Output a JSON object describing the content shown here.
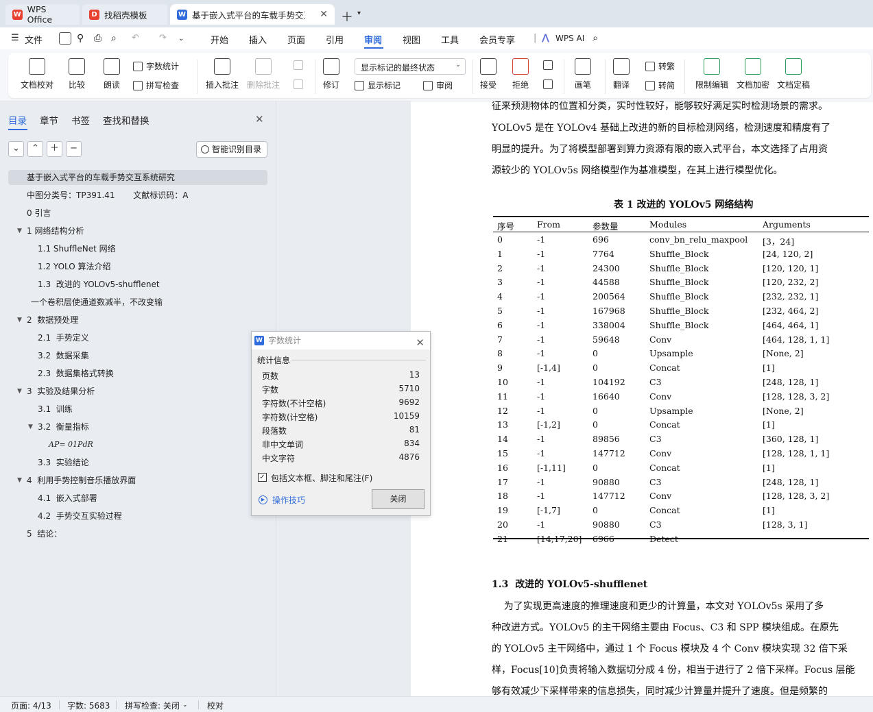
{
  "tabs": [
    {
      "label": "WPS Office",
      "icon": "wps-logo-icon"
    },
    {
      "label": "找稻壳模板",
      "icon": "docer-logo-icon"
    },
    {
      "label": "基于嵌入式平台的车载手势交互",
      "icon": "word-doc-icon"
    }
  ],
  "menu": {
    "file": "文件",
    "items": [
      "开始",
      "插入",
      "页面",
      "引用",
      "审阅",
      "视图",
      "工具",
      "会员专享"
    ],
    "active": "审阅",
    "ai": "WPS AI"
  },
  "ribbon": {
    "doc_check": "文档校对",
    "compare": "比较",
    "read_aloud": "朗读",
    "word_count": "字数统计",
    "spell_check": "拼写检查",
    "insert_comment": "插入批注",
    "delete_comment": "删除批注",
    "track_changes": "修订",
    "markup_state": "显示标记的最终状态",
    "show_markup": "显示标记",
    "review": "审阅",
    "accept": "接受",
    "reject": "拒绝",
    "pen": "画笔",
    "translate": "翻译",
    "to_traditional": "转繁",
    "to_simplified": "转简",
    "restrict_edit": "限制编辑",
    "encrypt": "文档加密",
    "finalize": "文档定稿"
  },
  "nav": {
    "tabs": [
      "目录",
      "章节",
      "书签",
      "查找和替换"
    ],
    "active_tab": "目录",
    "smart_toc": "智能识别目录",
    "toc": [
      {
        "text": "基于嵌入式平台的车载手势交互系统研究",
        "level": 0,
        "selected": true
      },
      {
        "text": "中图分类号：TP391.41       文献标识码：A",
        "level": 1
      },
      {
        "text": "0 引言",
        "level": 1
      },
      {
        "text": "1 网络结构分析",
        "level": 1,
        "expanded": true
      },
      {
        "text": "1.1 ShuffleNet 网络",
        "level": 2
      },
      {
        "text": "1.2 YOLO 算法介绍",
        "level": 2
      },
      {
        "text": "1.3  改进的 YOLOv5-shufflenet",
        "level": 2
      },
      {
        "text": "一个卷积层使通道数减半，不改变输",
        "level": 1
      },
      {
        "text": "2  数据预处理",
        "level": 1,
        "expanded": true
      },
      {
        "text": "2.1  手势定义",
        "level": 2
      },
      {
        "text": "3.2  数据采集",
        "level": 2
      },
      {
        "text": "2.3  数据集格式转换",
        "level": 2
      },
      {
        "text": "3  实验及结果分析",
        "level": 1,
        "expanded": true
      },
      {
        "text": "3.1  训练",
        "level": 2
      },
      {
        "text": "3.2  衡量指标",
        "level": 2,
        "expanded": true
      },
      {
        "text": "AP= 01PdR",
        "level": 3
      },
      {
        "text": "3.3  实验结论",
        "level": 2
      },
      {
        "text": "4  利用手势控制音乐播放界面",
        "level": 1,
        "expanded": true
      },
      {
        "text": "4.1  嵌入式部署",
        "level": 2
      },
      {
        "text": "4.2  手势交互实验过程",
        "level": 2
      },
      {
        "text": "5  结论：",
        "level": 1
      }
    ]
  },
  "document": {
    "paragraph1": [
      "征来预测物体的位置和分类，实时性较好，能够较好满足实时检测场景的需求。",
      "YOLOv5 是在 YOLOv4 基础上改进的新的目标检测网络，检测速度和精度有了",
      "明显的提升。为了将模型部署到算力资源有限的嵌入式平台，本文选择了占用资",
      "源较少的 YOLOv5s 网络模型作为基准模型，在其上进行模型优化。"
    ],
    "table_caption": "表 1  改进的 YOLOv5 网络结构",
    "table": {
      "headers": [
        "序号",
        "From",
        "参数量",
        "Modules",
        "Arguments"
      ],
      "rows": [
        [
          "0",
          "-1",
          "696",
          "conv_bn_relu_maxpool",
          "[3，24]"
        ],
        [
          "1",
          "-1",
          "7764",
          "Shuffle_Block",
          "[24, 120, 2]"
        ],
        [
          "2",
          "-1",
          "24300",
          "Shuffle_Block",
          "[120, 120, 1]"
        ],
        [
          "3",
          "-1",
          "44588",
          "Shuffle_Block",
          "[120, 232, 2]"
        ],
        [
          "4",
          "-1",
          "200564",
          "Shuffle_Block",
          "[232, 232, 1]"
        ],
        [
          "5",
          "-1",
          "167968",
          "Shuffle_Block",
          "[232, 464, 2]"
        ],
        [
          "6",
          "-1",
          "338004",
          "Shuffle_Block",
          "[464, 464, 1]"
        ],
        [
          "7",
          "-1",
          "59648",
          "Conv",
          "[464, 128, 1, 1]"
        ],
        [
          "8",
          "-1",
          "0",
          "Upsample",
          "[None, 2]"
        ],
        [
          "9",
          "[-1,4]",
          "0",
          "Concat",
          "[1]"
        ],
        [
          "10",
          "-1",
          "104192",
          "C3",
          "[248, 128, 1]"
        ],
        [
          "11",
          "-1",
          "16640",
          "Conv",
          "[128, 128, 3, 2]"
        ],
        [
          "12",
          "-1",
          "0",
          "Upsample",
          "[None, 2]"
        ],
        [
          "13",
          "[-1,2]",
          "0",
          "Concat",
          "[1]"
        ],
        [
          "14",
          "-1",
          "89856",
          "C3",
          "[360, 128, 1]"
        ],
        [
          "15",
          "-1",
          "147712",
          "Conv",
          "[128, 128, 1, 1]"
        ],
        [
          "16",
          "[-1,11]",
          "0",
          "Concat",
          "[1]"
        ],
        [
          "17",
          "-1",
          "90880",
          "C3",
          "[248, 128, 1]"
        ],
        [
          "18",
          "-1",
          "147712",
          "Conv",
          "[128, 128, 3, 2]"
        ],
        [
          "19",
          "[-1,7]",
          "0",
          "Concat",
          "[1]"
        ],
        [
          "20",
          "-1",
          "90880",
          "C3",
          "[128, 3, 1]"
        ],
        [
          "21",
          "[14,17,20]",
          "6966",
          "Detect",
          ""
        ]
      ]
    },
    "section_heading": "1.3  改进的 YOLOv5-shufflenet",
    "paragraph2": [
      "    为了实现更高速度的推理速度和更少的计算量，本文对 YOLOv5s 采用了多",
      "种改进方式。YOLOv5 的主干网络主要由 Focus、C3 和 SPP 模块组成。在原先",
      "的 YOLOv5 主干网络中，通过 1 个 Focus 模块及 4 个 Conv 模块实现 32 倍下采",
      "样，Focus[10]负责将输入数据切分成 4 份，相当于进行了 2 倍下采样。Focus 层能",
      "够有效减少下采样带来的信息损失，同时减少计算量并提升了速度。但是频繁的"
    ]
  },
  "dialog": {
    "title": "字数统计",
    "section": "统计信息",
    "stats": [
      {
        "label": "页数",
        "value": "13"
      },
      {
        "label": "字数",
        "value": "5710"
      },
      {
        "label": "字符数(不计空格)",
        "value": "9692"
      },
      {
        "label": "字符数(计空格)",
        "value": "10159"
      },
      {
        "label": "段落数",
        "value": "81"
      },
      {
        "label": "非中文单词",
        "value": "834"
      },
      {
        "label": "中文字符",
        "value": "4876"
      }
    ],
    "checkbox_label": "包括文本框、脚注和尾注(F)",
    "checkbox_checked": true,
    "tips": "操作技巧",
    "close": "关闭"
  },
  "status": {
    "page": "页面: 4/13",
    "words": "字数: 5683",
    "spell": "拼写检查: 关闭",
    "proof": "校对"
  }
}
